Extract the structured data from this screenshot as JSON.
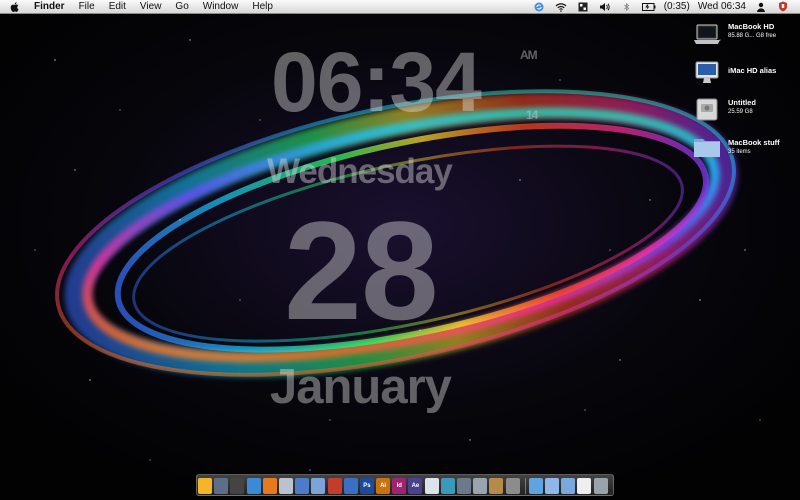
{
  "menubar": {
    "app": "Finder",
    "menus": [
      "File",
      "Edit",
      "View",
      "Go",
      "Window",
      "Help"
    ],
    "battery": "(0:35)",
    "clock": "Wed 06:34",
    "status_icons": [
      "sync-icon",
      "wifi-icon",
      "spaces-icon",
      "volume-icon",
      "bluetooth-icon",
      "battery-icon",
      "user-icon",
      "shield-icon"
    ]
  },
  "clock_widget": {
    "time": "06:34",
    "ampm": "AM",
    "seconds": "14",
    "weekday": "Wednesday",
    "day": "28",
    "month": "January"
  },
  "desktop": {
    "icons": [
      {
        "name": "MacBook HD",
        "detail": "85.88 G... G8 free",
        "icon": "macbook-icon"
      },
      {
        "name": "iMac HD alias",
        "detail": "",
        "icon": "imac-icon"
      },
      {
        "name": "Untitled",
        "detail": "25.59 G8",
        "icon": "drive-icon"
      },
      {
        "name": "MacBook stuff",
        "detail": "35 items",
        "icon": "folder-icon"
      }
    ]
  },
  "dock": {
    "items": [
      {
        "name": "finder-icon",
        "label": "",
        "color": "#f5b52b"
      },
      {
        "name": "dashboard-icon",
        "label": "",
        "color": "#5d6f86"
      },
      {
        "name": "clock-icon",
        "label": "",
        "color": "#444444"
      },
      {
        "name": "safari-icon",
        "label": "",
        "color": "#3a8ad6"
      },
      {
        "name": "firefox-icon",
        "label": "",
        "color": "#e87a1e"
      },
      {
        "name": "mail-icon",
        "label": "",
        "color": "#b9c3cf"
      },
      {
        "name": "itunes-icon",
        "label": "",
        "color": "#4a7cc9"
      },
      {
        "name": "ichat-icon",
        "label": "",
        "color": "#7da4d8"
      },
      {
        "name": "people-icon",
        "label": "",
        "color": "#c43c2c"
      },
      {
        "name": "preview-icon",
        "label": "",
        "color": "#3c6fc4"
      },
      {
        "name": "photoshop-icon",
        "label": "Ps",
        "color": "#1f4a9a"
      },
      {
        "name": "illustrator-icon",
        "label": "Ai",
        "color": "#c77210"
      },
      {
        "name": "indesign-icon",
        "label": "Id",
        "color": "#a0236e"
      },
      {
        "name": "aftereffects-icon",
        "label": "Ae",
        "color": "#4b3f8f"
      },
      {
        "name": "calendar-icon",
        "label": "",
        "color": "#dde3ea"
      },
      {
        "name": "colorsync-icon",
        "label": "",
        "color": "#3b9ab9"
      },
      {
        "name": "textedit-icon",
        "label": "",
        "color": "#6a7a8a"
      },
      {
        "name": "macbook-icon",
        "label": "",
        "color": "#9aa4ae"
      },
      {
        "name": "box-icon",
        "label": "",
        "color": "#b88a4a"
      },
      {
        "name": "preferences-icon",
        "label": "",
        "color": "#8c8c8c"
      },
      {
        "name": "separator",
        "label": "",
        "color": ""
      },
      {
        "name": "downloads-icon",
        "label": "",
        "color": "#5fa3e0"
      },
      {
        "name": "folder-icon",
        "label": "",
        "color": "#8fb7e8"
      },
      {
        "name": "documents-icon",
        "label": "",
        "color": "#7aa8dc"
      },
      {
        "name": "document-icon",
        "label": "",
        "color": "#eeeeee"
      },
      {
        "name": "trash-icon",
        "label": "",
        "color": "#9aa3ab"
      }
    ]
  }
}
